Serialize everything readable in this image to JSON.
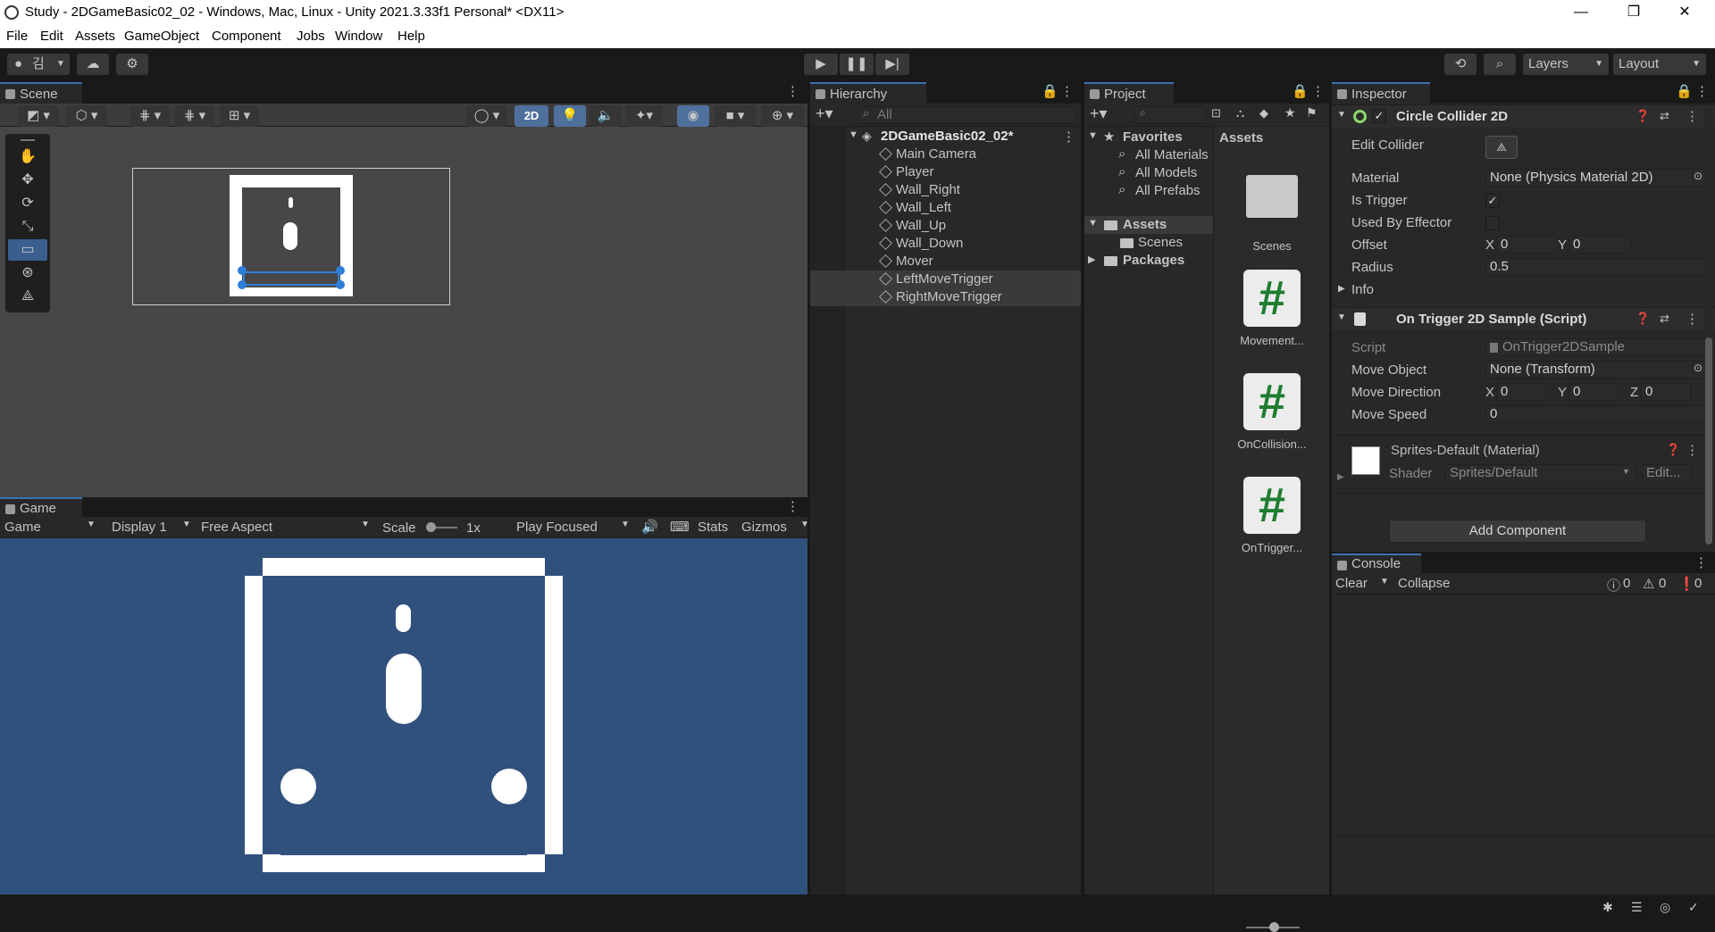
{
  "window": {
    "title": "Study - 2DGameBasic02_02 - Windows, Mac, Linux - Unity 2021.3.33f1 Personal* <DX11>",
    "min": "—",
    "max": "❐",
    "close": "✕"
  },
  "menu": [
    "File",
    "Edit",
    "Assets",
    "GameObject",
    "Component",
    "Jobs",
    "Window",
    "Help"
  ],
  "toolbar": {
    "account": "김",
    "layers": "Layers",
    "layout": "Layout"
  },
  "scene": {
    "tab": "Scene",
    "mode_2d": "2D"
  },
  "game": {
    "tab": "Game",
    "view": "Game",
    "display": "Display 1",
    "aspect": "Free Aspect",
    "scale_label": "Scale",
    "scale_value": "1x",
    "play_mode": "Play Focused",
    "stats": "Stats",
    "gizmos": "Gizmos",
    "bg_color": "#31517d"
  },
  "hierarchy": {
    "tab": "Hierarchy",
    "search_placeholder": "All",
    "scene_name": "2DGameBasic02_02*",
    "items": [
      "Main Camera",
      "Player",
      "Wall_Right",
      "Wall_Left",
      "Wall_Up",
      "Wall_Down",
      "Mover",
      "LeftMoveTrigger",
      "RightMoveTrigger"
    ]
  },
  "project": {
    "tab": "Project",
    "favorites": "Favorites",
    "fav_items": [
      "All Materials",
      "All Models",
      "All Prefabs"
    ],
    "assets": "Assets",
    "scenes": "Scenes",
    "packages": "Packages",
    "breadcrumb": "Assets",
    "grid": [
      "Scenes",
      "Movement...",
      "OnCollision...",
      "OnTrigger..."
    ]
  },
  "inspector": {
    "tab": "Inspector",
    "collider": {
      "title": "Circle Collider 2D",
      "edit_collider": "Edit Collider",
      "material_label": "Material",
      "material_value": "None (Physics Material 2D)",
      "is_trigger": "Is Trigger",
      "used_by_effector": "Used By Effector",
      "offset": "Offset",
      "offset_x": "0",
      "offset_y": "0",
      "radius": "Radius",
      "radius_value": "0.5",
      "info": "Info"
    },
    "script": {
      "title": "On Trigger 2D Sample (Script)",
      "script_label": "Script",
      "script_value": "OnTrigger2DSample",
      "move_object": "Move Object",
      "move_object_value": "None (Transform)",
      "move_direction": "Move Direction",
      "dir_x": "0",
      "dir_y": "0",
      "dir_z": "0",
      "move_speed": "Move Speed",
      "move_speed_value": "0"
    },
    "material": {
      "name": "Sprites-Default (Material)",
      "shader_label": "Shader",
      "shader_value": "Sprites/Default",
      "edit": "Edit..."
    },
    "add_component": "Add Component",
    "axis_x": "X",
    "axis_y": "Y",
    "axis_z": "Z"
  },
  "console": {
    "tab": "Console",
    "clear": "Clear",
    "collapse": "Collapse",
    "log_count": "0",
    "warn_count": "0",
    "error_count": "0"
  }
}
